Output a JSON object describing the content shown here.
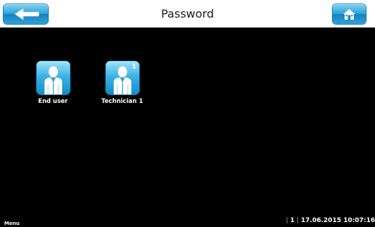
{
  "header": {
    "title": "Password",
    "back_icon": "back-arrow-icon",
    "home_icon": "home-icon"
  },
  "users": [
    {
      "label": "End user",
      "badge": "",
      "icon": "user-icon"
    },
    {
      "label": "Technician 1",
      "badge": "1",
      "icon": "technician-icon"
    }
  ],
  "footer": {
    "menu_label": "Menu",
    "page_indicator": "1",
    "datetime": "17.06.2015 10:07:16"
  },
  "colors": {
    "accent": "#2ea2d8",
    "background": "#000000",
    "header_bg": "#ffffff"
  }
}
